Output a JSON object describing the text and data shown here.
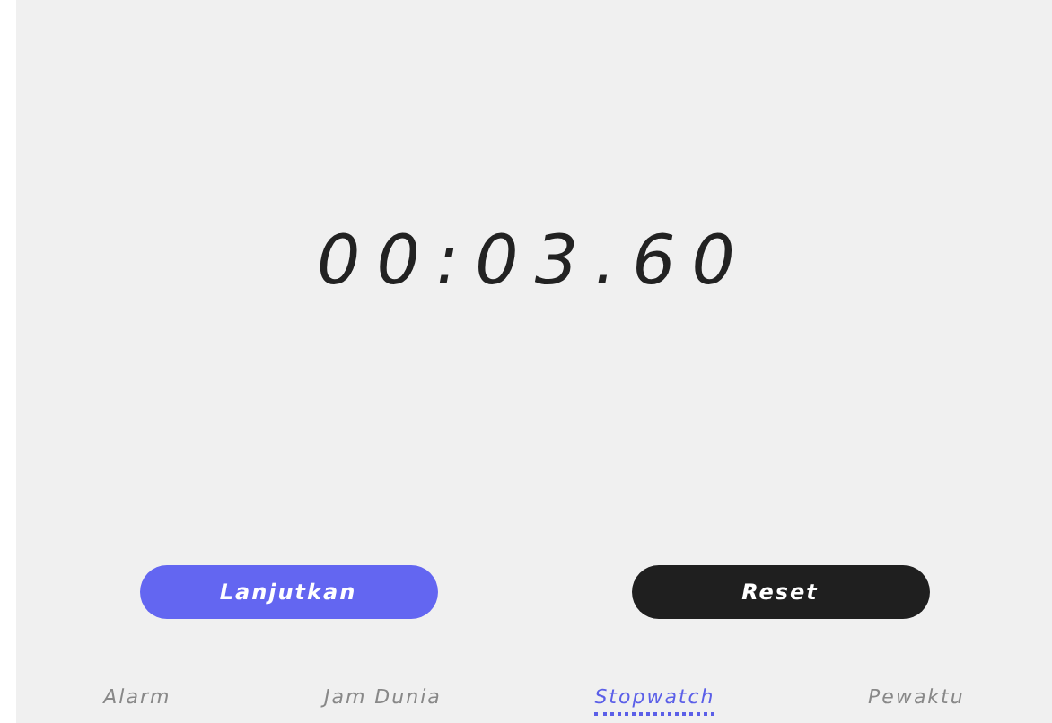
{
  "stopwatch": {
    "time": "00:03.60"
  },
  "buttons": [
    {
      "label": "Lanjutkan",
      "kind": "primary"
    },
    {
      "label": "Reset",
      "kind": "dark"
    }
  ],
  "tabs": [
    {
      "label": "Alarm",
      "selected": false
    },
    {
      "label": "Jam Dunia",
      "selected": false
    },
    {
      "label": "Stopwatch",
      "selected": true
    },
    {
      "label": "Pewaktu",
      "selected": false
    }
  ]
}
